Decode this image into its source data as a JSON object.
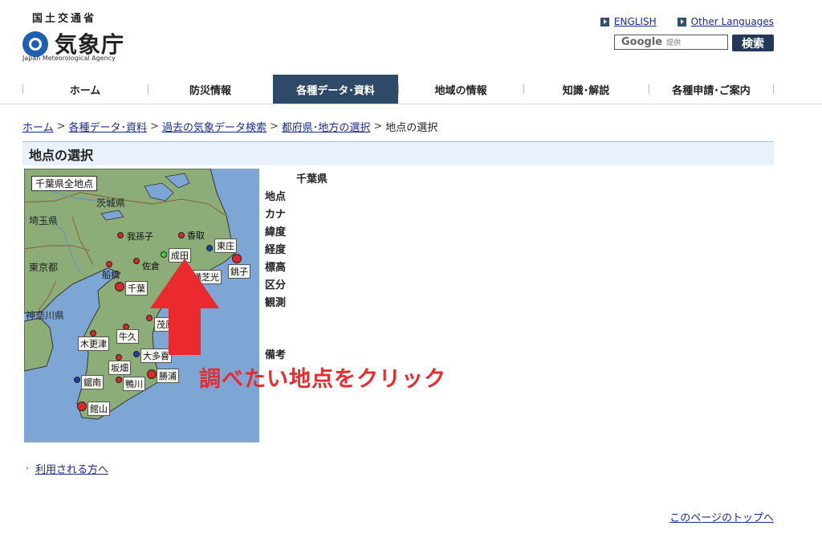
{
  "header": {
    "ministry": "国土交通省",
    "agency_name": "気象庁",
    "agency_en": "Japan Meteorological Agency",
    "links": [
      {
        "label": "ENGLISH"
      },
      {
        "label": "Other Languages"
      }
    ],
    "search": {
      "brand": "Google",
      "provided": "提供",
      "button": "検索"
    }
  },
  "nav": {
    "items": [
      {
        "label": "ホーム"
      },
      {
        "label": "防災情報"
      },
      {
        "label": "各種データ･資料"
      },
      {
        "label": "地域の情報"
      },
      {
        "label": "知識･解説"
      },
      {
        "label": "各種申請･ご案内"
      }
    ],
    "active_index": 2
  },
  "breadcrumb": {
    "links": [
      {
        "label": "ホーム"
      },
      {
        "label": "各種データ･資料"
      },
      {
        "label": "過去の気象データ検索"
      },
      {
        "label": "都府県･地方の選択"
      }
    ],
    "separator": ">",
    "current": "地点の選択"
  },
  "section_title": "地点の選択",
  "map": {
    "title": "千葉県全地点",
    "regions": [
      "茨城県",
      "埼玉県",
      "東京都",
      "神奈川県"
    ],
    "stations": [
      {
        "name": "香取",
        "type": "red"
      },
      {
        "name": "我孫子",
        "type": "red"
      },
      {
        "name": "東庄",
        "type": "blue"
      },
      {
        "name": "成田",
        "type": "green"
      },
      {
        "name": "佐倉",
        "type": "red"
      },
      {
        "name": "船橋",
        "type": "red"
      },
      {
        "name": "横芝光",
        "type": "red"
      },
      {
        "name": "銚子",
        "type": "major"
      },
      {
        "name": "千葉",
        "type": "major"
      },
      {
        "name": "茂原",
        "type": "red"
      },
      {
        "name": "牛久",
        "type": "red"
      },
      {
        "name": "木更津",
        "type": "red"
      },
      {
        "name": "大多喜",
        "type": "blue"
      },
      {
        "name": "坂畑",
        "type": "red"
      },
      {
        "name": "勝浦",
        "type": "major"
      },
      {
        "name": "鋸南",
        "type": "blue"
      },
      {
        "name": "鴨川",
        "type": "red"
      },
      {
        "name": "館山",
        "type": "major"
      }
    ],
    "colors": {
      "sea": "#7ea6d4",
      "land": "#8cac78",
      "red": "#d9282a",
      "blue": "#1a3fb0",
      "green": "#38d848"
    }
  },
  "info": {
    "prefecture": "千葉県",
    "labels": [
      "地点",
      "カナ",
      "緯度",
      "経度",
      "標高",
      "区分",
      "観測",
      "備考"
    ]
  },
  "instruction": "調べたい地点をクリック",
  "footer": {
    "user_link": "利用される方へ",
    "page_top": "このページのトップへ"
  }
}
